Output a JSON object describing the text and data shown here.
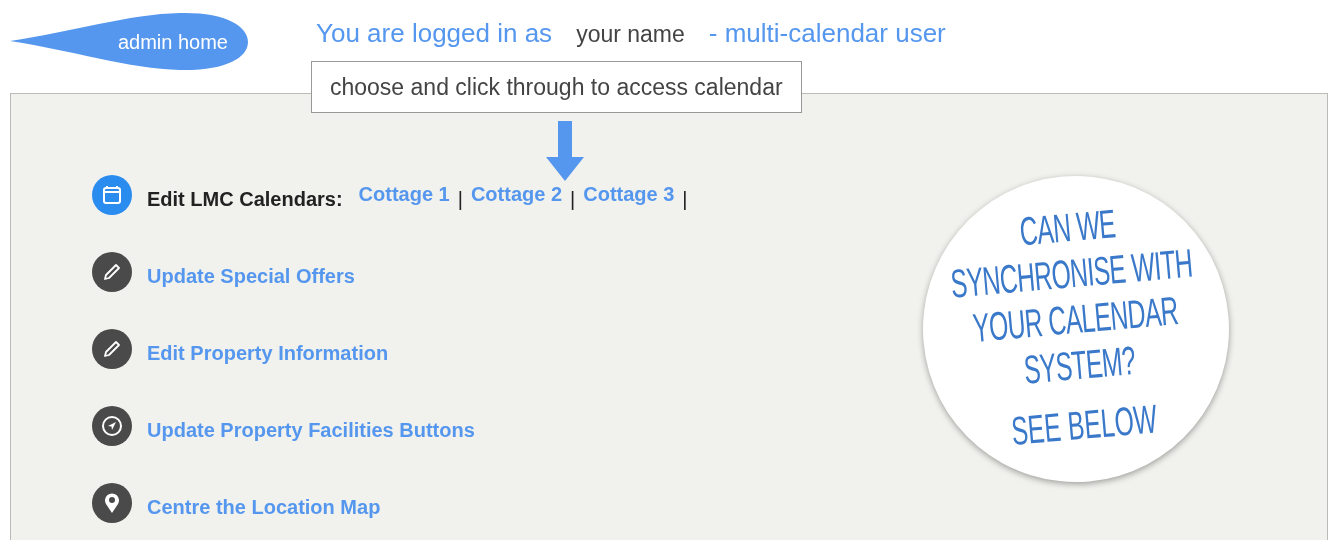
{
  "header": {
    "home_button": "admin home",
    "login_prefix": "You are logged in as",
    "user_name": "your name",
    "user_role": "- multi-calendar user",
    "callout": "choose and click through to access calendar"
  },
  "menu": [
    {
      "kind": "calendars",
      "label": "Edit LMC Calendars:",
      "links": [
        {
          "label": "Cottage 1",
          "separator": "|"
        },
        {
          "label": "Cottage 2",
          "separator": "|"
        },
        {
          "label": "Cottage 3",
          "separator": "|"
        }
      ]
    },
    {
      "kind": "link",
      "label": "Update Special Offers"
    },
    {
      "kind": "link",
      "label": "Edit Property Information"
    },
    {
      "kind": "link",
      "label": "Update Property Facilities Buttons"
    },
    {
      "kind": "link",
      "label": "Centre the Location Map"
    }
  ],
  "badge": {
    "question_lines": [
      "CAN WE",
      "SYNCHRONISE WITH",
      "YOUR CALENDAR",
      "SYSTEM?"
    ],
    "footer": "SEE BELOW"
  }
}
